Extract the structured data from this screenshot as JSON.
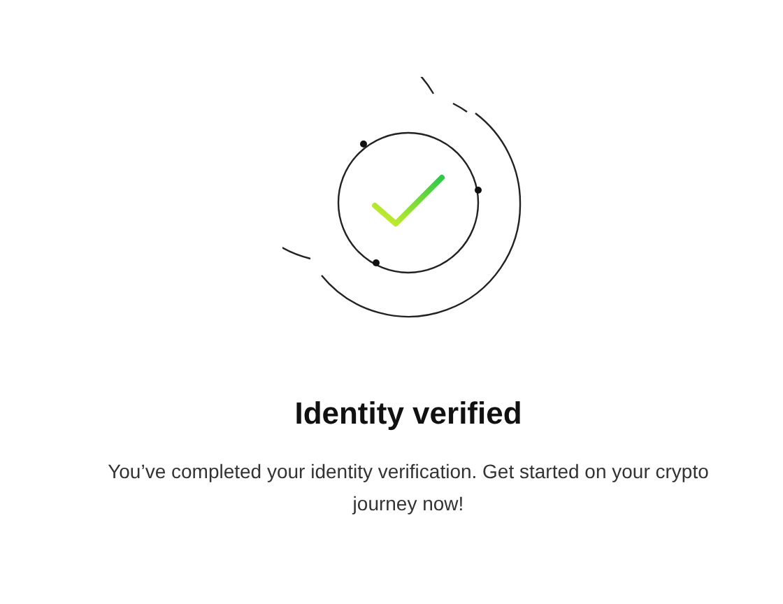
{
  "title": "Identity verified",
  "message": "You’ve completed your identity verification. Get started on your crypto journey now!"
}
